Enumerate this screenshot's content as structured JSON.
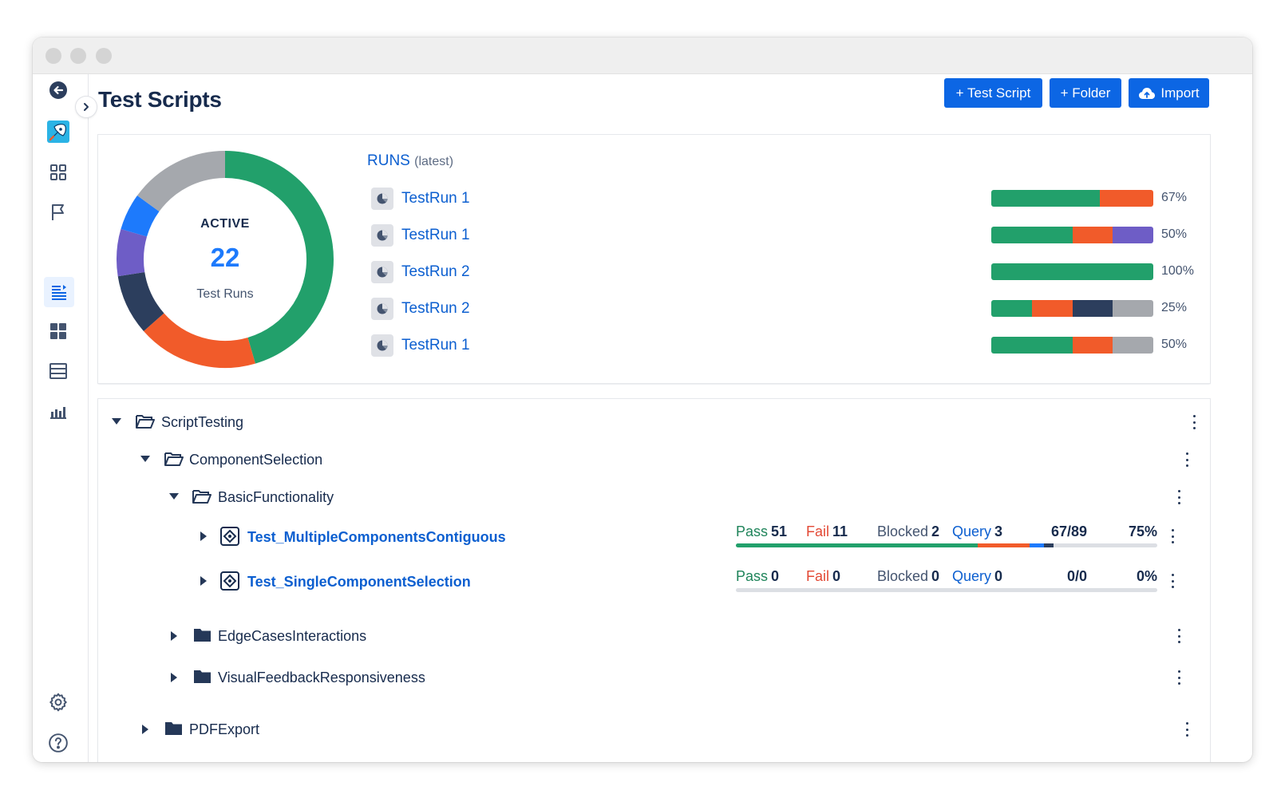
{
  "page": {
    "title": "Test Scripts"
  },
  "toolbar": {
    "test_script_label": "+ Test Script",
    "folder_label": "+ Folder",
    "import_label": "Import"
  },
  "sidebar": {
    "icons": [
      "back-arrow-icon",
      "rocket-logo-icon",
      "grid-icon",
      "flag-icon",
      "list-icon",
      "dashboard-icon",
      "table-icon",
      "bar-chart-icon",
      "gear-icon",
      "help-icon"
    ],
    "active": "list-icon"
  },
  "summary": {
    "donut": {
      "status": "ACTIVE",
      "count": "22",
      "caption": "Test Runs",
      "segments": [
        {
          "color": "#22a06b",
          "fraction": 0.455
        },
        {
          "color": "#f15b2a",
          "fraction": 0.18
        },
        {
          "color": "#2c3e5d",
          "fraction": 0.09
        },
        {
          "color": "#6e5dc6",
          "fraction": 0.07
        },
        {
          "color": "#1d7afc",
          "fraction": 0.055
        },
        {
          "color": "#a5a8ad",
          "fraction": 0.15
        }
      ]
    },
    "runs_title": "RUNS",
    "runs_subtitle": "(latest)",
    "runs": [
      {
        "name": "TestRun 1",
        "pct": "67%",
        "segments": [
          {
            "color": "#22a06b",
            "fraction": 0.67
          },
          {
            "color": "#f15b2a",
            "fraction": 0.33
          }
        ]
      },
      {
        "name": "TestRun 1",
        "pct": "50%",
        "segments": [
          {
            "color": "#22a06b",
            "fraction": 0.5
          },
          {
            "color": "#f15b2a",
            "fraction": 0.25
          },
          {
            "color": "#6e5dc6",
            "fraction": 0.25
          }
        ]
      },
      {
        "name": "TestRun 2",
        "pct": "100%",
        "segments": [
          {
            "color": "#22a06b",
            "fraction": 1.0
          }
        ]
      },
      {
        "name": "TestRun 2",
        "pct": "25%",
        "segments": [
          {
            "color": "#22a06b",
            "fraction": 0.25
          },
          {
            "color": "#f15b2a",
            "fraction": 0.25
          },
          {
            "color": "#2c3e5d",
            "fraction": 0.25
          },
          {
            "color": "#a5a8ad",
            "fraction": 0.25
          }
        ]
      },
      {
        "name": "TestRun 1",
        "pct": "50%",
        "segments": [
          {
            "color": "#22a06b",
            "fraction": 0.5
          },
          {
            "color": "#f15b2a",
            "fraction": 0.25
          },
          {
            "color": "#a5a8ad",
            "fraction": 0.25
          }
        ]
      }
    ]
  },
  "tree": {
    "folders": {
      "root": "ScriptTesting",
      "component_selection": "ComponentSelection",
      "basic_functionality": "BasicFunctionality",
      "edge_cases": "EdgeCasesInteractions",
      "visual_feedback": "VisualFeedbackResponsiveness",
      "pdf_export": "PDFExport"
    },
    "scripts": [
      {
        "name": "Test_MultipleComponentsContiguous",
        "pass_label": "Pass",
        "pass": "51",
        "fail_label": "Fail",
        "fail": "11",
        "blocked_label": "Blocked",
        "blocked": "2",
        "query_label": "Query",
        "query": "3",
        "ratio": "67/89",
        "pct": "75%",
        "bar": [
          {
            "color": "#22a06b",
            "fraction": 0.573
          },
          {
            "color": "#f15b2a",
            "fraction": 0.124
          },
          {
            "color": "#1d7afc",
            "fraction": 0.034
          },
          {
            "color": "#2c3e5d",
            "fraction": 0.022
          }
        ]
      },
      {
        "name": "Test_SingleComponentSelection",
        "pass_label": "Pass",
        "pass": "0",
        "fail_label": "Fail",
        "fail": "0",
        "blocked_label": "Blocked",
        "blocked": "0",
        "query_label": "Query",
        "query": "0",
        "ratio": "0/0",
        "pct": "0%",
        "bar": []
      }
    ]
  }
}
